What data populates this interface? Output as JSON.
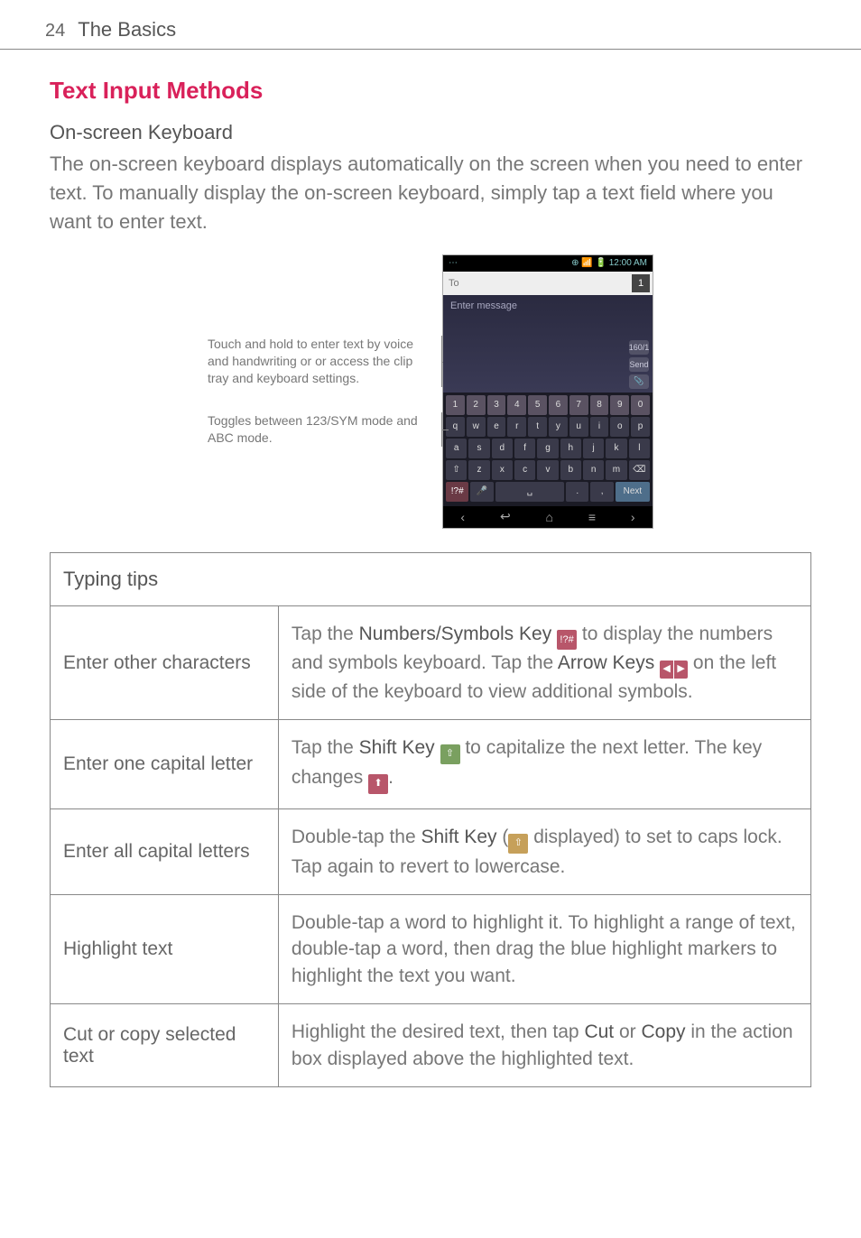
{
  "page": {
    "number": "24",
    "breadcrumb": "The Basics"
  },
  "section": {
    "title": "Text Input Methods",
    "subhead": "On-screen Keyboard",
    "intro": "The on-screen keyboard displays automatically on the screen when you need to enter text. To manually display the on-screen keyboard, simply tap a text field where you want to enter text."
  },
  "figure": {
    "label_hold": "Touch and hold to enter text by voice and handwriting or or access the clip tray and keyboard settings.",
    "label_toggle": "Toggles between 123/SYM mode and ABC mode.",
    "status_time": "12:00 AM",
    "to_placeholder": "To",
    "to_count": "1",
    "msg_placeholder": "Enter message",
    "char_chip": "160/1",
    "send_chip": "Send",
    "row1": [
      "1",
      "2",
      "3",
      "4",
      "5",
      "6",
      "7",
      "8",
      "9",
      "0"
    ],
    "row2": [
      "q",
      "w",
      "e",
      "r",
      "t",
      "y",
      "u",
      "i",
      "o",
      "p"
    ],
    "row3": [
      "a",
      "s",
      "d",
      "f",
      "g",
      "h",
      "j",
      "k",
      "l"
    ],
    "row4": [
      "⇧",
      "z",
      "x",
      "c",
      "v",
      "b",
      "n",
      "m",
      "⌫"
    ],
    "row5_mode": "!?#",
    "row5_mic": "🎤",
    "row5_space": "␣",
    "row5_dot": ".",
    "row5_comma": ",",
    "row5_next": "Next",
    "nav_back": "↩",
    "nav_home": "⌂",
    "nav_recent": "≡",
    "nav_l": "‹",
    "nav_r": "›"
  },
  "table": {
    "header": "Typing tips",
    "rows": [
      {
        "left": "Enter other characters",
        "r_pre": "Tap the ",
        "r_b1": "Numbers/Symbols Key",
        "r_mid1": " to display the numbers and symbols keyboard. Tap the ",
        "r_b2": "Arrow Keys",
        "r_post": " on the left side of the keyboard to view additional symbols."
      },
      {
        "left": "Enter one capital letter",
        "r_pre": "Tap the ",
        "r_b1": "Shift Key",
        "r_mid1": " to capitalize the next letter. The key changes ",
        "r_post": "."
      },
      {
        "left": "Enter all capital letters",
        "r_pre": "Double-tap the ",
        "r_b1": "Shift Key",
        "r_mid1": " (",
        "r_mid2": " displayed) to set to caps lock. Tap again to revert to lowercase."
      },
      {
        "left": "Highlight text",
        "right": "Double-tap a word to highlight it. To highlight a range of text, double-tap a word, then drag the blue highlight markers to highlight the text you want."
      },
      {
        "left": "Cut or copy selected text",
        "r_pre": "Highlight the desired text, then tap ",
        "r_b1": "Cut",
        "r_mid1": " or ",
        "r_b2": "Copy",
        "r_post": " in the action box displayed above the highlighted text."
      }
    ]
  }
}
